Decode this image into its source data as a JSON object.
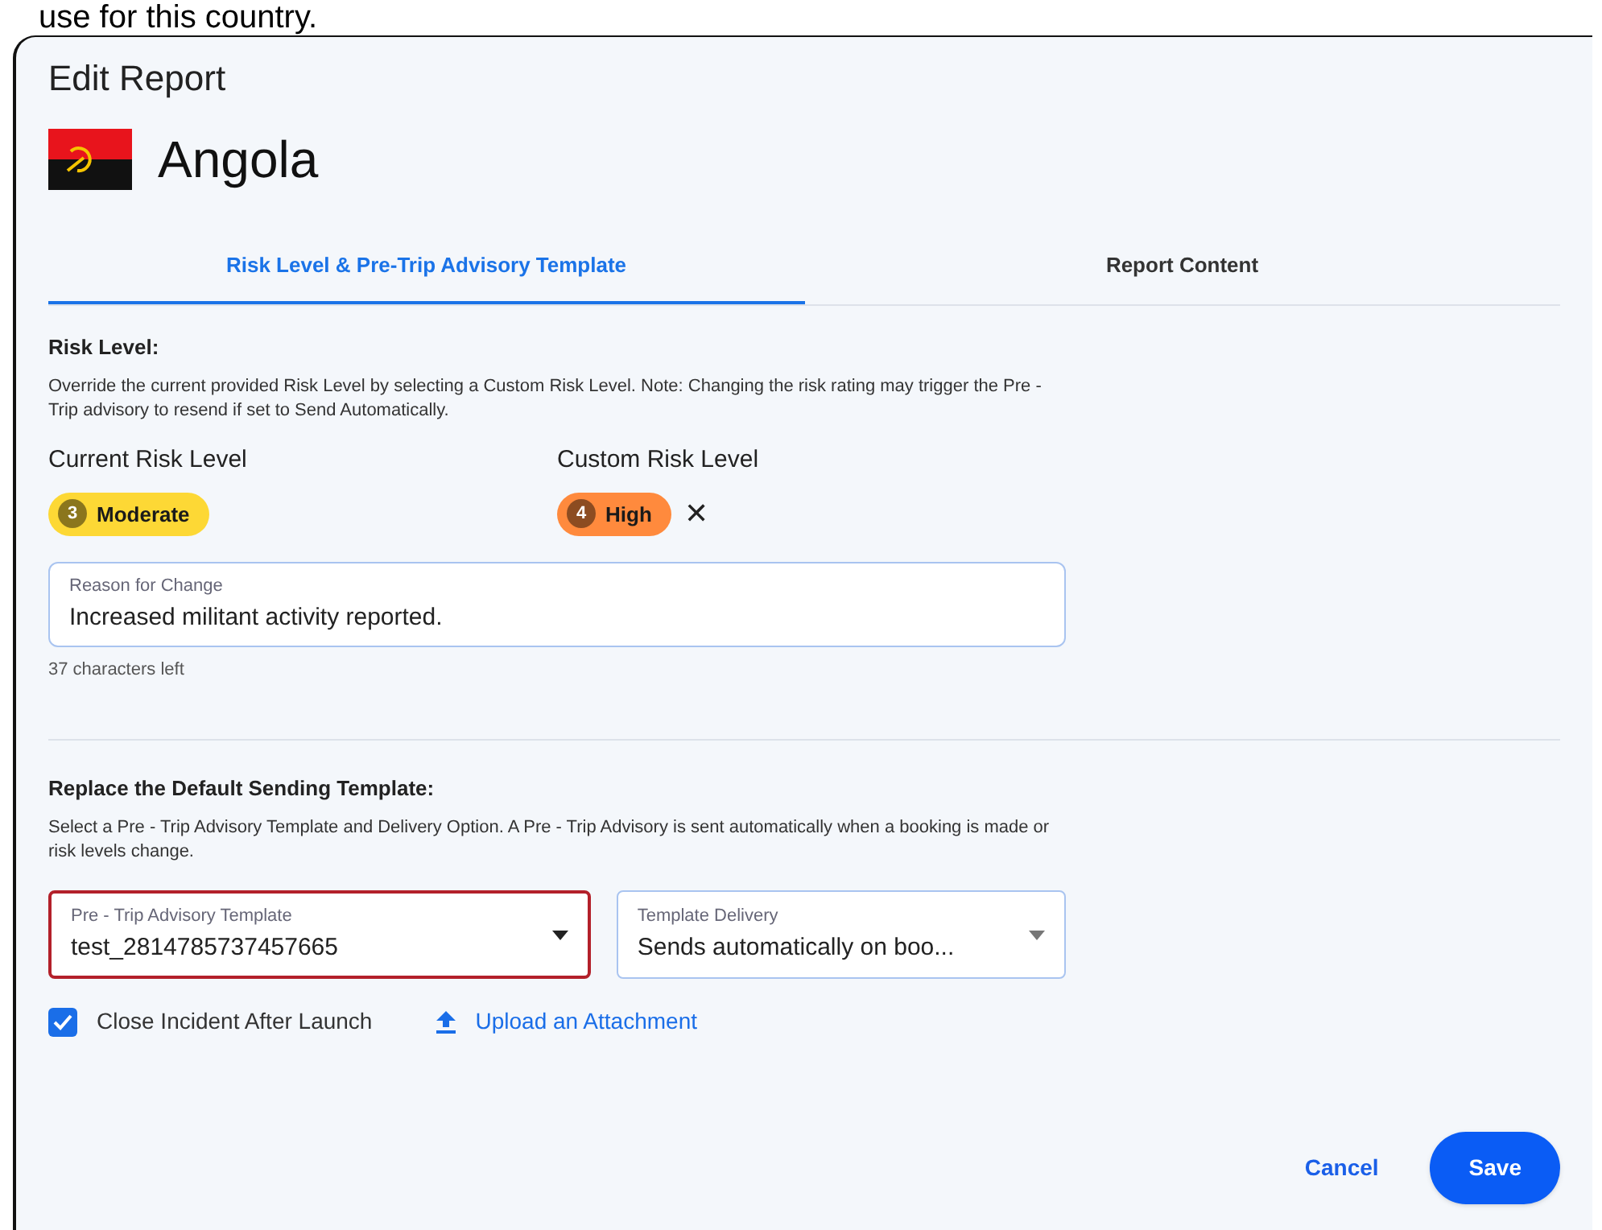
{
  "caption": "use for this country.",
  "dialog": {
    "title": "Edit Report",
    "country": "Angola"
  },
  "tabs": [
    {
      "label": "Risk Level & Pre-Trip Advisory Template",
      "selected": true
    },
    {
      "label": "Report Content",
      "selected": false
    }
  ],
  "risk_section": {
    "heading": "Risk Level:",
    "description": "Override the current provided Risk Level by selecting a Custom Risk Level. Note: Changing the risk rating may trigger the Pre - Trip advisory to resend if set to Send Automatically.",
    "current": {
      "label": "Current Risk Level",
      "badge": {
        "number": "3",
        "text": "Moderate",
        "color": "#fdd835"
      }
    },
    "custom": {
      "label": "Custom Risk Level",
      "badge": {
        "number": "4",
        "text": "High",
        "color": "#ff8a3d"
      },
      "clear": "✕"
    },
    "reason": {
      "label": "Reason for Change",
      "value": "Increased militant activity reported.",
      "hint": "37 characters left"
    }
  },
  "template_section": {
    "heading": "Replace the Default Sending Template:",
    "description": "Select a Pre - Trip Advisory Template and Delivery Option. A Pre - Trip Advisory is sent automatically when a booking is made or risk levels change.",
    "selects": [
      {
        "label": "Pre - Trip Advisory Template",
        "value": "test_2814785737457665",
        "error": true
      },
      {
        "label": "Template Delivery",
        "value": "Sends automatically on boo...",
        "error": false
      }
    ],
    "checkbox": {
      "label": "Close Incident After Launch",
      "checked": true
    },
    "upload": "Upload an Attachment"
  },
  "buttons": [
    {
      "label": "Cancel",
      "kind": "text"
    },
    {
      "label": "Save",
      "kind": "primary"
    }
  ]
}
